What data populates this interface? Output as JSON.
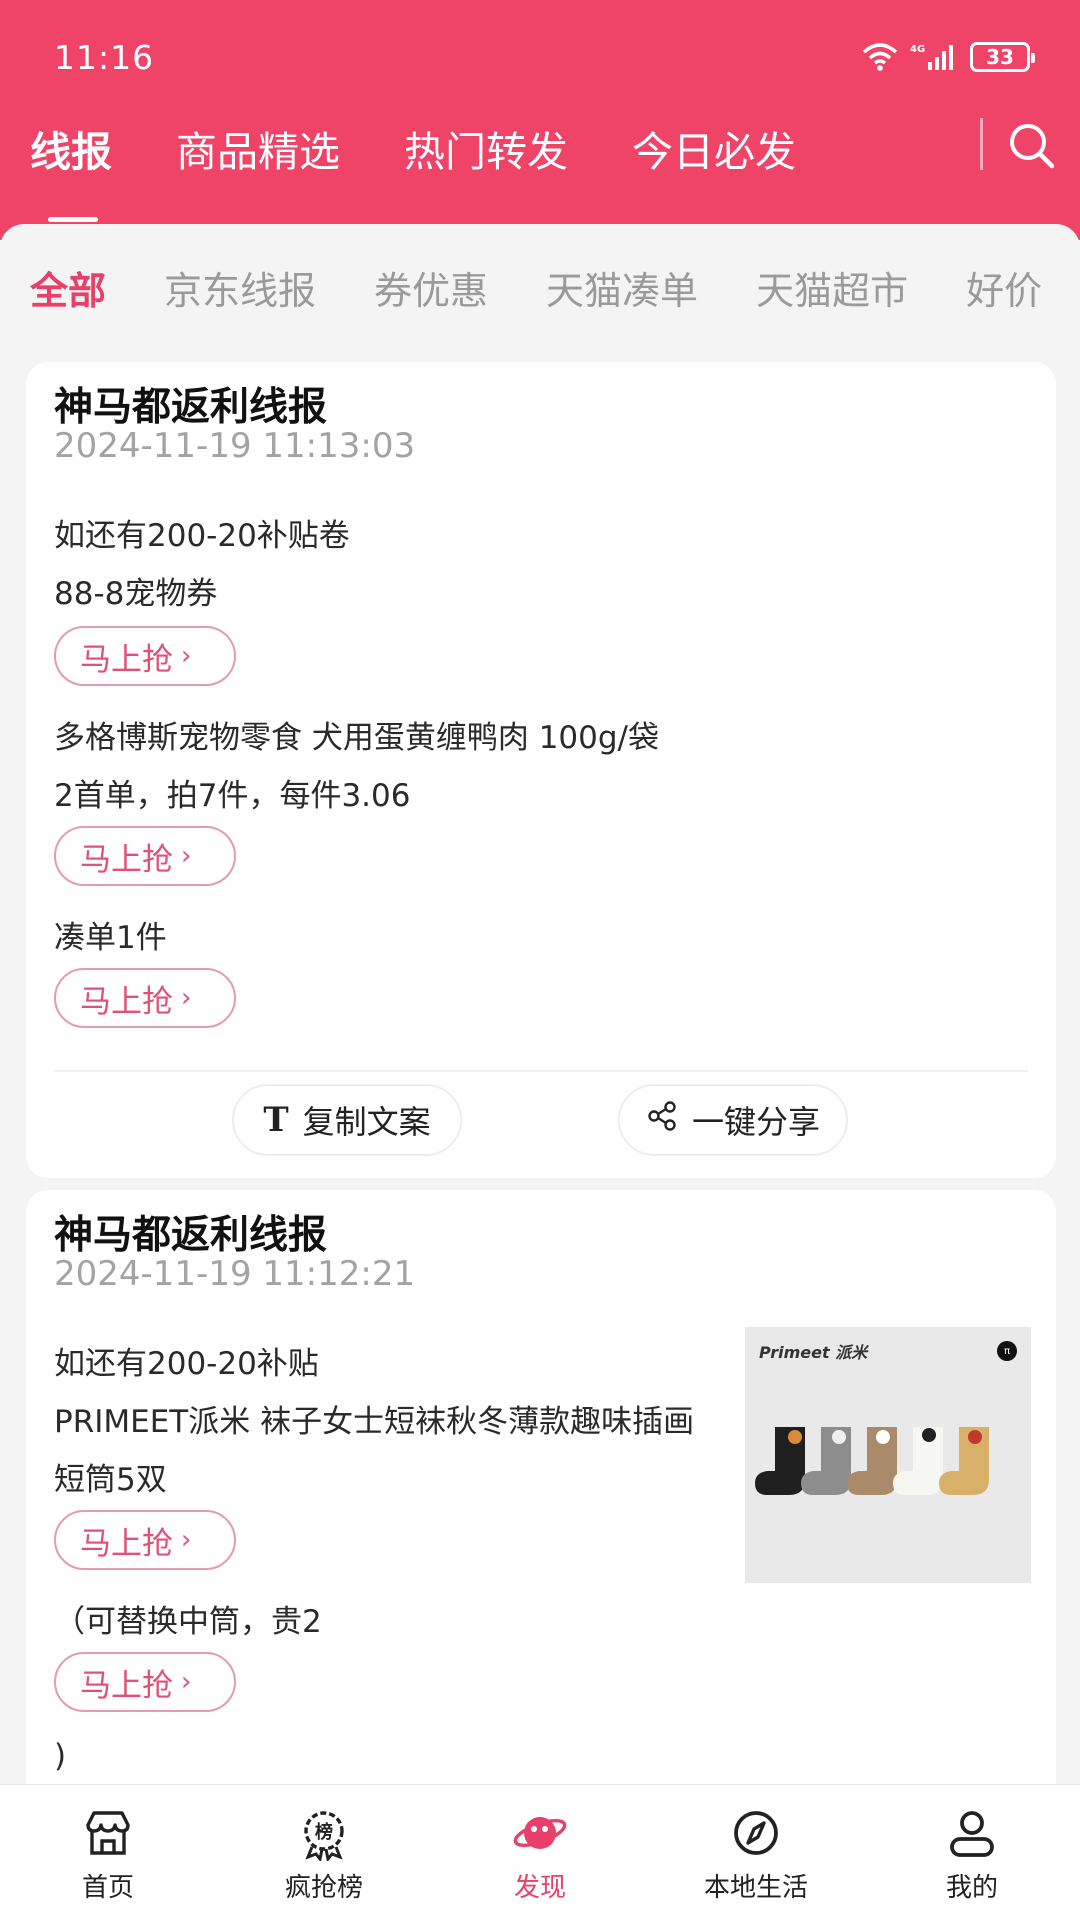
{
  "status_bar": {
    "time": "11:16",
    "battery": "33",
    "network": "4G"
  },
  "top_tabs": [
    {
      "label": "线报",
      "active": true
    },
    {
      "label": "商品精选",
      "active": false
    },
    {
      "label": "热门转发",
      "active": false
    },
    {
      "label": "今日必发",
      "active": false
    }
  ],
  "category_tabs": [
    {
      "label": "全部",
      "active": true
    },
    {
      "label": "京东线报",
      "active": false
    },
    {
      "label": "券优惠",
      "active": false
    },
    {
      "label": "天猫凑单",
      "active": false
    },
    {
      "label": "天猫超市",
      "active": false
    },
    {
      "label": "好价",
      "active": false
    }
  ],
  "grab_label": "马上抢",
  "cards": [
    {
      "title": "神马都返利线报",
      "time": "2024-11-19 11:13:03",
      "lines": [
        "如还有200-20补贴卷",
        "88-8宠物券",
        "多格博斯宠物零食 犬用蛋黄缠鸭肉 100g/袋",
        "2首单，拍7件，每件3.06",
        "凑单1件"
      ],
      "actions": {
        "copy": "复制文案",
        "share": "一键分享"
      }
    },
    {
      "title": "神马都返利线报",
      "time": "2024-11-19 11:12:21",
      "lines": [
        "如还有200-20补贴",
        "PRIMEET派米 袜子女士短袜秋冬薄款趣味插画",
        "短筒5双",
        "（可替换中筒，贵2",
        ")"
      ],
      "product_brand": "Primeet 派米",
      "product_badge": "π"
    }
  ],
  "bottom_nav": [
    {
      "label": "首页",
      "icon": "home-store-icon",
      "active": false
    },
    {
      "label": "疯抢榜",
      "icon": "ranking-badge-icon",
      "active": false
    },
    {
      "label": "发现",
      "icon": "planet-icon",
      "active": true
    },
    {
      "label": "本地生活",
      "icon": "compass-icon",
      "active": false
    },
    {
      "label": "我的",
      "icon": "user-icon",
      "active": false
    }
  ],
  "colors": {
    "brand": "#ef4468",
    "accent": "#e8406a",
    "background": "#f4f4f4"
  }
}
